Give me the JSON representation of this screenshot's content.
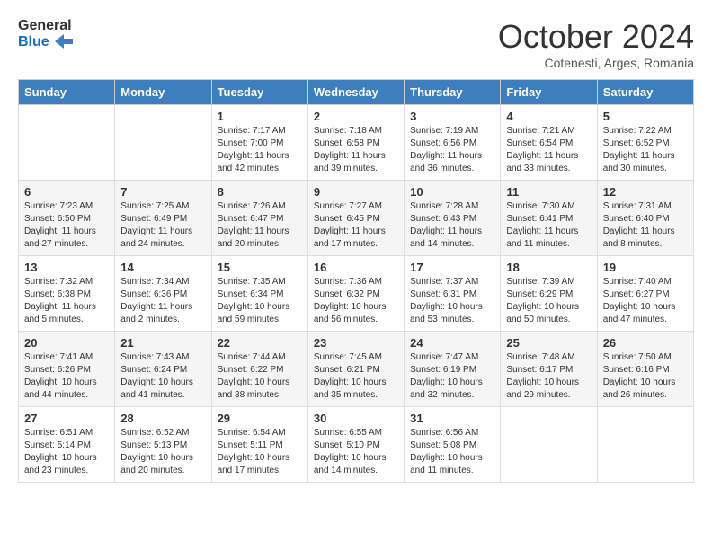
{
  "header": {
    "logo_line1": "General",
    "logo_line2": "Blue",
    "month": "October 2024",
    "location": "Cotenesti, Arges, Romania"
  },
  "days_of_week": [
    "Sunday",
    "Monday",
    "Tuesday",
    "Wednesday",
    "Thursday",
    "Friday",
    "Saturday"
  ],
  "weeks": [
    [
      {
        "day": "",
        "info": ""
      },
      {
        "day": "",
        "info": ""
      },
      {
        "day": "1",
        "info": "Sunrise: 7:17 AM\nSunset: 7:00 PM\nDaylight: 11 hours and 42 minutes."
      },
      {
        "day": "2",
        "info": "Sunrise: 7:18 AM\nSunset: 6:58 PM\nDaylight: 11 hours and 39 minutes."
      },
      {
        "day": "3",
        "info": "Sunrise: 7:19 AM\nSunset: 6:56 PM\nDaylight: 11 hours and 36 minutes."
      },
      {
        "day": "4",
        "info": "Sunrise: 7:21 AM\nSunset: 6:54 PM\nDaylight: 11 hours and 33 minutes."
      },
      {
        "day": "5",
        "info": "Sunrise: 7:22 AM\nSunset: 6:52 PM\nDaylight: 11 hours and 30 minutes."
      }
    ],
    [
      {
        "day": "6",
        "info": "Sunrise: 7:23 AM\nSunset: 6:50 PM\nDaylight: 11 hours and 27 minutes."
      },
      {
        "day": "7",
        "info": "Sunrise: 7:25 AM\nSunset: 6:49 PM\nDaylight: 11 hours and 24 minutes."
      },
      {
        "day": "8",
        "info": "Sunrise: 7:26 AM\nSunset: 6:47 PM\nDaylight: 11 hours and 20 minutes."
      },
      {
        "day": "9",
        "info": "Sunrise: 7:27 AM\nSunset: 6:45 PM\nDaylight: 11 hours and 17 minutes."
      },
      {
        "day": "10",
        "info": "Sunrise: 7:28 AM\nSunset: 6:43 PM\nDaylight: 11 hours and 14 minutes."
      },
      {
        "day": "11",
        "info": "Sunrise: 7:30 AM\nSunset: 6:41 PM\nDaylight: 11 hours and 11 minutes."
      },
      {
        "day": "12",
        "info": "Sunrise: 7:31 AM\nSunset: 6:40 PM\nDaylight: 11 hours and 8 minutes."
      }
    ],
    [
      {
        "day": "13",
        "info": "Sunrise: 7:32 AM\nSunset: 6:38 PM\nDaylight: 11 hours and 5 minutes."
      },
      {
        "day": "14",
        "info": "Sunrise: 7:34 AM\nSunset: 6:36 PM\nDaylight: 11 hours and 2 minutes."
      },
      {
        "day": "15",
        "info": "Sunrise: 7:35 AM\nSunset: 6:34 PM\nDaylight: 10 hours and 59 minutes."
      },
      {
        "day": "16",
        "info": "Sunrise: 7:36 AM\nSunset: 6:32 PM\nDaylight: 10 hours and 56 minutes."
      },
      {
        "day": "17",
        "info": "Sunrise: 7:37 AM\nSunset: 6:31 PM\nDaylight: 10 hours and 53 minutes."
      },
      {
        "day": "18",
        "info": "Sunrise: 7:39 AM\nSunset: 6:29 PM\nDaylight: 10 hours and 50 minutes."
      },
      {
        "day": "19",
        "info": "Sunrise: 7:40 AM\nSunset: 6:27 PM\nDaylight: 10 hours and 47 minutes."
      }
    ],
    [
      {
        "day": "20",
        "info": "Sunrise: 7:41 AM\nSunset: 6:26 PM\nDaylight: 10 hours and 44 minutes."
      },
      {
        "day": "21",
        "info": "Sunrise: 7:43 AM\nSunset: 6:24 PM\nDaylight: 10 hours and 41 minutes."
      },
      {
        "day": "22",
        "info": "Sunrise: 7:44 AM\nSunset: 6:22 PM\nDaylight: 10 hours and 38 minutes."
      },
      {
        "day": "23",
        "info": "Sunrise: 7:45 AM\nSunset: 6:21 PM\nDaylight: 10 hours and 35 minutes."
      },
      {
        "day": "24",
        "info": "Sunrise: 7:47 AM\nSunset: 6:19 PM\nDaylight: 10 hours and 32 minutes."
      },
      {
        "day": "25",
        "info": "Sunrise: 7:48 AM\nSunset: 6:17 PM\nDaylight: 10 hours and 29 minutes."
      },
      {
        "day": "26",
        "info": "Sunrise: 7:50 AM\nSunset: 6:16 PM\nDaylight: 10 hours and 26 minutes."
      }
    ],
    [
      {
        "day": "27",
        "info": "Sunrise: 6:51 AM\nSunset: 5:14 PM\nDaylight: 10 hours and 23 minutes."
      },
      {
        "day": "28",
        "info": "Sunrise: 6:52 AM\nSunset: 5:13 PM\nDaylight: 10 hours and 20 minutes."
      },
      {
        "day": "29",
        "info": "Sunrise: 6:54 AM\nSunset: 5:11 PM\nDaylight: 10 hours and 17 minutes."
      },
      {
        "day": "30",
        "info": "Sunrise: 6:55 AM\nSunset: 5:10 PM\nDaylight: 10 hours and 14 minutes."
      },
      {
        "day": "31",
        "info": "Sunrise: 6:56 AM\nSunset: 5:08 PM\nDaylight: 10 hours and 11 minutes."
      },
      {
        "day": "",
        "info": ""
      },
      {
        "day": "",
        "info": ""
      }
    ]
  ]
}
